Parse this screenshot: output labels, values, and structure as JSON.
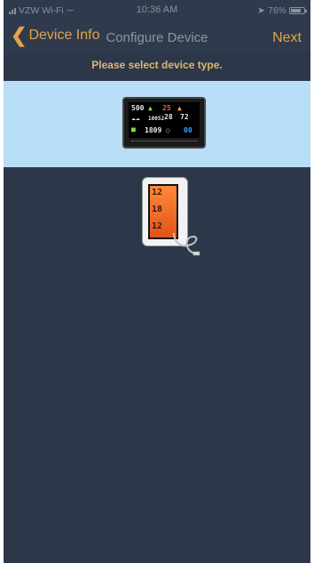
{
  "status_bar": {
    "carrier": "VZW Wi-Fi",
    "time": "10:36 AM",
    "battery_percent": "76%",
    "battery_level": 0.76
  },
  "nav": {
    "back_label": "Device Info",
    "title": "Configure Device",
    "next_label": "Next"
  },
  "prompt": "Please select device type.",
  "device_options": [
    {
      "name": "weather-station-display",
      "selected": true,
      "screen_text": [
        "500",
        "25",
        "10052",
        "28",
        "72",
        "1809",
        "00"
      ]
    },
    {
      "name": "indoor-outdoor-thermometer",
      "selected": false,
      "screen_text": [
        "12",
        "18",
        "12"
      ]
    }
  ],
  "colors": {
    "background": "#2c3849",
    "accent": "#e6a24a",
    "selected_row": "#b8ddf7"
  }
}
